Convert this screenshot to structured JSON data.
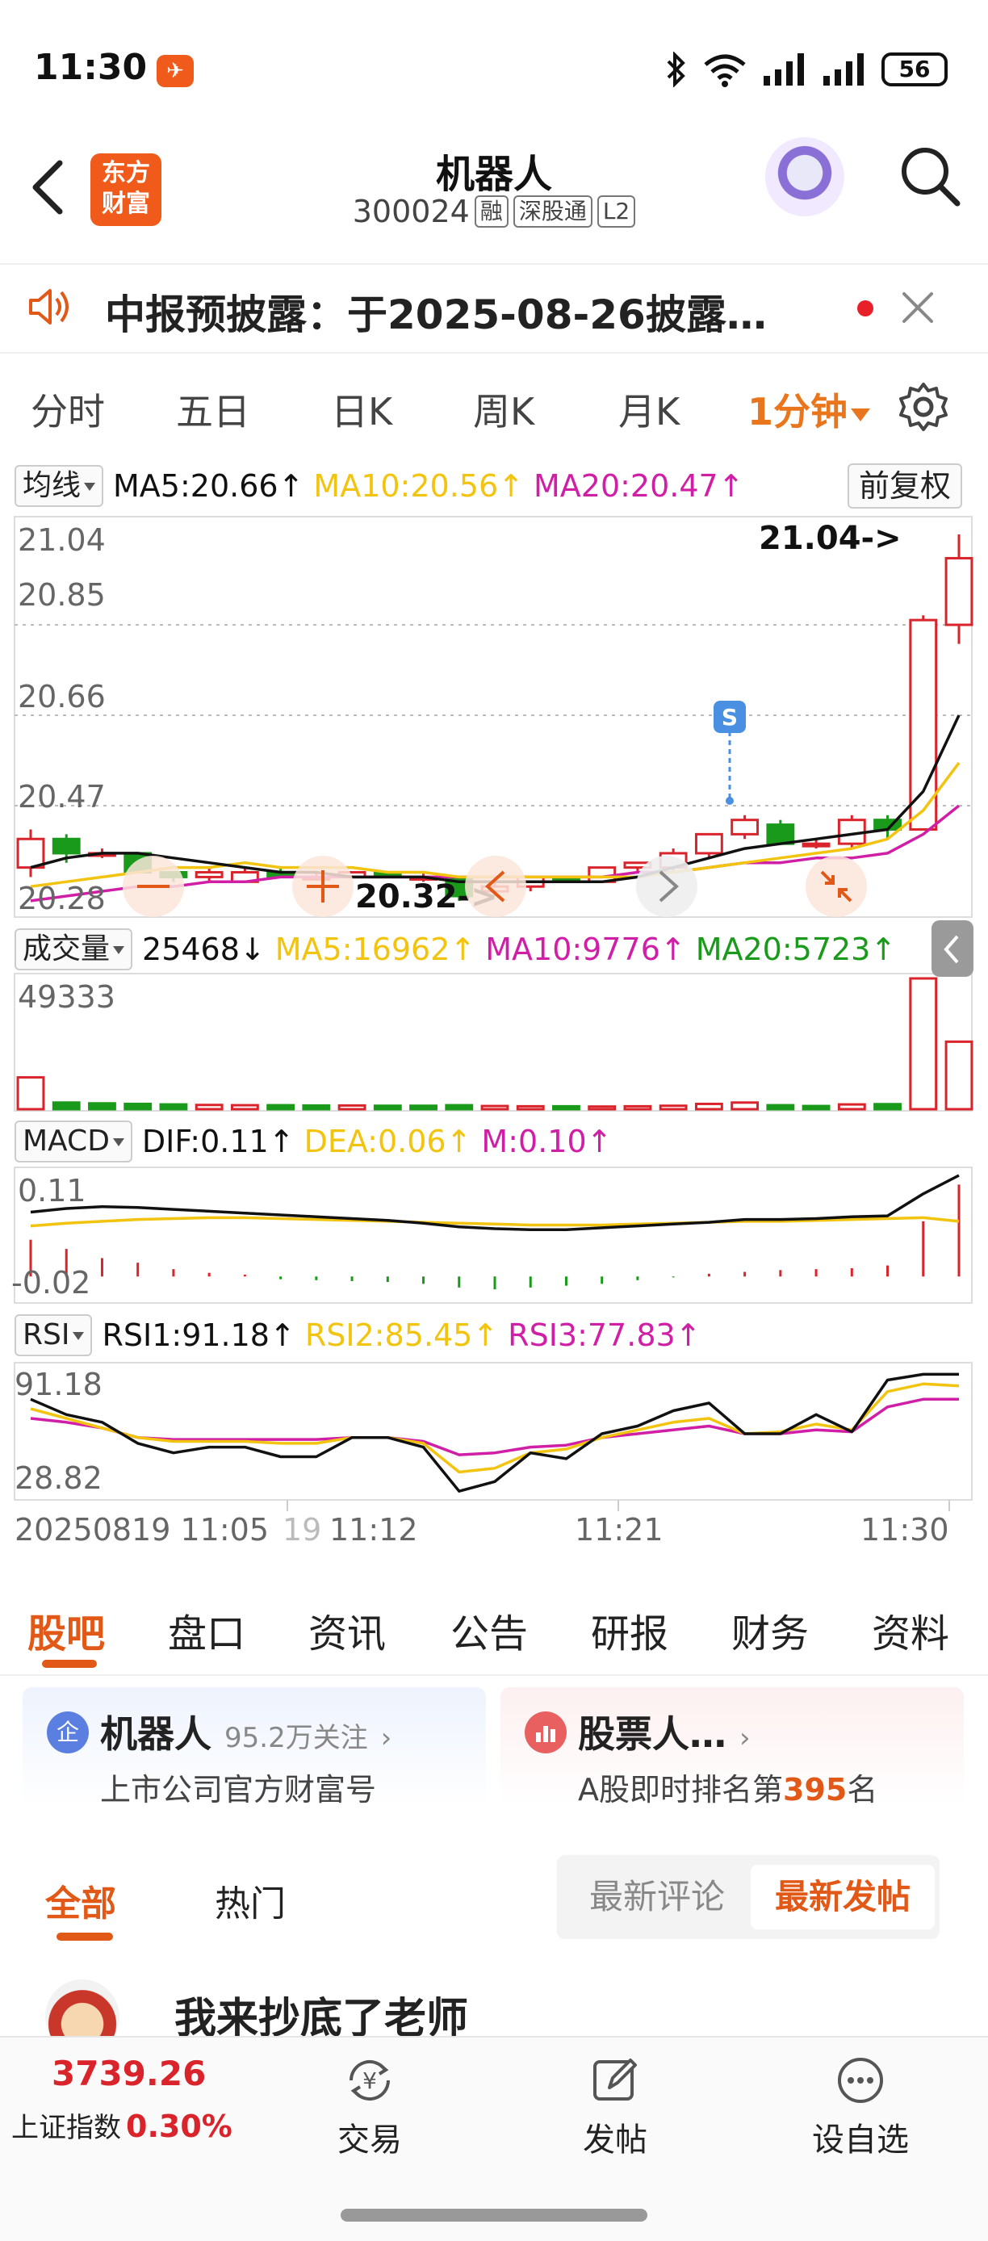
{
  "status_bar": {
    "time": "11:30",
    "battery": "56"
  },
  "header": {
    "title": "机器人",
    "code": "300024",
    "tags": [
      "融",
      "深股通",
      "L2"
    ],
    "brand_logo": "东方财富"
  },
  "notice": {
    "text": "中报预披露：于2025-08-26披露…"
  },
  "period_tabs": [
    "分时",
    "五日",
    "日K",
    "周K",
    "月K"
  ],
  "active_period": "1分钟",
  "indicators": {
    "ma": {
      "selector": "均线",
      "ma5": "MA5:20.66↑",
      "ma10": "MA10:20.56↑",
      "ma20": "MA20:20.47↑",
      "adjust": "前复权"
    },
    "volume": {
      "selector": "成交量",
      "value": "25468↓",
      "ma5": "MA5:16962↑",
      "ma10": "MA10:9776↑",
      "ma20": "MA20:5723↑"
    },
    "macd": {
      "selector": "MACD",
      "dif": "DIF:0.11↑",
      "dea": "DEA:0.06↑",
      "m": "M:0.10↑"
    },
    "rsi": {
      "selector": "RSI",
      "rsi1": "RSI1:91.18↑",
      "rsi2": "RSI2:85.45↑",
      "rsi3": "RSI3:77.83↑"
    }
  },
  "chart_labels": {
    "price_ticks": [
      "21.04",
      "20.85",
      "20.66",
      "20.47",
      "20.28"
    ],
    "high_marker": "21.04->",
    "low_marker": "20.32->",
    "s_marker": "S",
    "volume_tick": "49333",
    "macd_ticks": [
      "0.11",
      "-0.02"
    ],
    "rsi_ticks": [
      "91.18",
      "28.82"
    ],
    "time_start": "20250819 11:05",
    "time_partial": "19",
    "time_ticks": [
      "11:12",
      "11:21",
      "11:30"
    ]
  },
  "colors": {
    "up": "#d9242b",
    "down": "#1a9a1a",
    "ma5": "#111111",
    "ma10": "#f2c40f",
    "ma20": "#d01fa6",
    "accent": "#e25816"
  },
  "chart_data": [
    {
      "type": "candlestick",
      "title": "",
      "ylim": [
        20.28,
        21.04
      ],
      "candles": [
        {
          "o": 20.34,
          "c": 20.4,
          "h": 20.42,
          "l": 20.32
        },
        {
          "o": 20.4,
          "c": 20.37,
          "h": 20.41,
          "l": 20.35
        },
        {
          "o": 20.37,
          "c": 20.37,
          "h": 20.38,
          "l": 20.36
        },
        {
          "o": 20.37,
          "c": 20.33,
          "h": 20.37,
          "l": 20.33
        },
        {
          "o": 20.33,
          "c": 20.32,
          "h": 20.33,
          "l": 20.31
        },
        {
          "o": 20.32,
          "c": 20.33,
          "h": 20.34,
          "l": 20.31
        },
        {
          "o": 20.31,
          "c": 20.33,
          "h": 20.34,
          "l": 20.31
        },
        {
          "o": 20.33,
          "c": 20.32,
          "h": 20.34,
          "l": 20.32
        },
        {
          "o": 20.32,
          "c": 20.32,
          "h": 20.33,
          "l": 20.32
        },
        {
          "o": 20.32,
          "c": 20.33,
          "h": 20.33,
          "l": 20.32
        },
        {
          "o": 20.33,
          "c": 20.32,
          "h": 20.33,
          "l": 20.32
        },
        {
          "o": 20.32,
          "c": 20.32,
          "h": 20.33,
          "l": 20.31
        },
        {
          "o": 20.32,
          "c": 20.28,
          "h": 20.32,
          "l": 20.27
        },
        {
          "o": 20.29,
          "c": 20.3,
          "h": 20.31,
          "l": 20.28
        },
        {
          "o": 20.3,
          "c": 20.32,
          "h": 20.32,
          "l": 20.29
        },
        {
          "o": 20.32,
          "c": 20.31,
          "h": 20.32,
          "l": 20.31
        },
        {
          "o": 20.31,
          "c": 20.34,
          "h": 20.34,
          "l": 20.31
        },
        {
          "o": 20.34,
          "c": 20.35,
          "h": 20.35,
          "l": 20.33
        },
        {
          "o": 20.34,
          "c": 20.37,
          "h": 20.38,
          "l": 20.33
        },
        {
          "o": 20.37,
          "c": 20.41,
          "h": 20.41,
          "l": 20.36
        },
        {
          "o": 20.41,
          "c": 20.44,
          "h": 20.45,
          "l": 20.4
        },
        {
          "o": 20.43,
          "c": 20.39,
          "h": 20.44,
          "l": 20.39
        },
        {
          "o": 20.39,
          "c": 20.39,
          "h": 20.4,
          "l": 20.38
        },
        {
          "o": 20.39,
          "c": 20.44,
          "h": 20.45,
          "l": 20.38
        },
        {
          "o": 20.44,
          "c": 20.42,
          "h": 20.45,
          "l": 20.4
        },
        {
          "o": 20.42,
          "c": 20.86,
          "h": 20.87,
          "l": 20.42
        },
        {
          "o": 20.85,
          "c": 20.99,
          "h": 21.04,
          "l": 20.81
        }
      ],
      "ma5": [
        20.34,
        20.36,
        20.37,
        20.37,
        20.36,
        20.35,
        20.34,
        20.33,
        20.33,
        20.32,
        20.32,
        20.32,
        20.31,
        20.31,
        20.31,
        20.31,
        20.31,
        20.32,
        20.34,
        20.36,
        20.38,
        20.39,
        20.4,
        20.41,
        20.42,
        20.5,
        20.66
      ],
      "ma10": [
        20.3,
        20.31,
        20.32,
        20.33,
        20.34,
        20.34,
        20.35,
        20.34,
        20.34,
        20.34,
        20.33,
        20.33,
        20.32,
        20.32,
        20.32,
        20.32,
        20.32,
        20.32,
        20.33,
        20.34,
        20.35,
        20.36,
        20.37,
        20.38,
        20.4,
        20.46,
        20.56
      ],
      "ma20": [
        20.27,
        20.28,
        20.29,
        20.3,
        20.3,
        20.31,
        20.31,
        20.32,
        20.32,
        20.32,
        20.32,
        20.32,
        20.32,
        20.32,
        20.32,
        20.32,
        20.32,
        20.33,
        20.33,
        20.34,
        20.35,
        20.35,
        20.36,
        20.36,
        20.37,
        20.41,
        20.47
      ]
    },
    {
      "type": "bar",
      "title": "成交量",
      "ylim": [
        0,
        49333
      ],
      "values": [
        12000,
        2500,
        2200,
        2000,
        1800,
        1600,
        1500,
        1500,
        1400,
        1400,
        1300,
        1300,
        1500,
        1200,
        1100,
        1100,
        1000,
        1100,
        1300,
        2000,
        2500,
        1500,
        1200,
        1800,
        1900,
        49333,
        25468
      ],
      "up": [
        true,
        false,
        false,
        false,
        false,
        true,
        true,
        false,
        false,
        true,
        false,
        false,
        false,
        true,
        true,
        false,
        true,
        true,
        true,
        true,
        true,
        false,
        false,
        true,
        false,
        true,
        true
      ]
    },
    {
      "type": "bar",
      "title": "MACD",
      "ylim": [
        -0.02,
        0.11
      ],
      "values": [
        0.04,
        0.03,
        0.02,
        0.015,
        0.008,
        0.004,
        0.002,
        -0.003,
        -0.004,
        -0.005,
        -0.006,
        -0.008,
        -0.012,
        -0.014,
        -0.012,
        -0.01,
        -0.008,
        -0.004,
        -0.001,
        0.003,
        0.005,
        0.007,
        0.008,
        0.009,
        0.012,
        0.06,
        0.1
      ],
      "dif": [
        0.07,
        0.074,
        0.076,
        0.075,
        0.073,
        0.071,
        0.069,
        0.067,
        0.065,
        0.063,
        0.061,
        0.058,
        0.054,
        0.052,
        0.051,
        0.051,
        0.053,
        0.055,
        0.057,
        0.059,
        0.062,
        0.062,
        0.063,
        0.065,
        0.066,
        0.09,
        0.11
      ],
      "dea": [
        0.055,
        0.058,
        0.06,
        0.062,
        0.063,
        0.064,
        0.064,
        0.063,
        0.062,
        0.061,
        0.06,
        0.059,
        0.058,
        0.057,
        0.056,
        0.056,
        0.056,
        0.057,
        0.058,
        0.059,
        0.06,
        0.06,
        0.061,
        0.062,
        0.063,
        0.064,
        0.06
      ]
    },
    {
      "type": "line",
      "title": "RSI",
      "ylim": [
        28.82,
        91.18
      ],
      "series": [
        {
          "name": "RSI1",
          "values": [
            78,
            70,
            66,
            55,
            50,
            53,
            53,
            48,
            48,
            58,
            58,
            53,
            30,
            35,
            50,
            47,
            60,
            64,
            72,
            76,
            60,
            60,
            70,
            61,
            88,
            91,
            91
          ]
        },
        {
          "name": "RSI2",
          "values": [
            73,
            68,
            63,
            58,
            56,
            56,
            56,
            55,
            55,
            58,
            58,
            55,
            40,
            42,
            50,
            52,
            58,
            62,
            66,
            68,
            60,
            61,
            65,
            62,
            82,
            86,
            85
          ]
        },
        {
          "name": "RSI3",
          "values": [
            68,
            66,
            63,
            58,
            57,
            57,
            57,
            57,
            57,
            58,
            58,
            56,
            49,
            50,
            53,
            54,
            58,
            60,
            62,
            64,
            60,
            60,
            62,
            61,
            74,
            78,
            78
          ]
        }
      ]
    }
  ],
  "section_tabs": [
    "股吧",
    "盘口",
    "资讯",
    "公告",
    "研报",
    "财务",
    "资料"
  ],
  "cards": [
    {
      "icon": "企",
      "title": "机器人",
      "meta": "95.2万关注",
      "subtitle": "上市公司官方财富号"
    },
    {
      "title": "股票人…",
      "subtitle_prefix": "A股即时排名第",
      "rank": "395",
      "subtitle_suffix": "名"
    }
  ],
  "feed_tabs": [
    "全部",
    "热门"
  ],
  "sort_options": [
    "最新评论",
    "最新发帖"
  ],
  "post": {
    "text": "我来抄底了老师"
  },
  "bottom_bar": {
    "index_value": "3739.26",
    "index_name": "上证指数",
    "index_change": "0.30%",
    "nav": [
      "交易",
      "发帖",
      "设自选"
    ]
  }
}
